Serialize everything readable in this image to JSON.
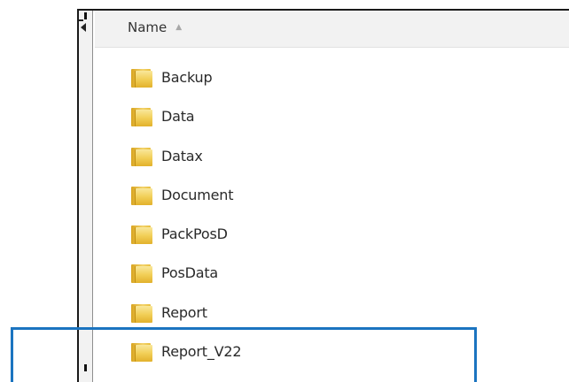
{
  "columns": {
    "name_label": "Name",
    "sort_indicator": "▲"
  },
  "folders": [
    {
      "name": "Backup"
    },
    {
      "name": "Data"
    },
    {
      "name": "Datax"
    },
    {
      "name": "Document"
    },
    {
      "name": "PackPosD"
    },
    {
      "name": "PosData"
    },
    {
      "name": "Report"
    },
    {
      "name": "Report_V22"
    }
  ],
  "highlight": {
    "target": "Report_V22",
    "color": "#1b74c0"
  },
  "icons": {
    "folder": "folder-icon",
    "sort": "sort-ascending-icon"
  }
}
